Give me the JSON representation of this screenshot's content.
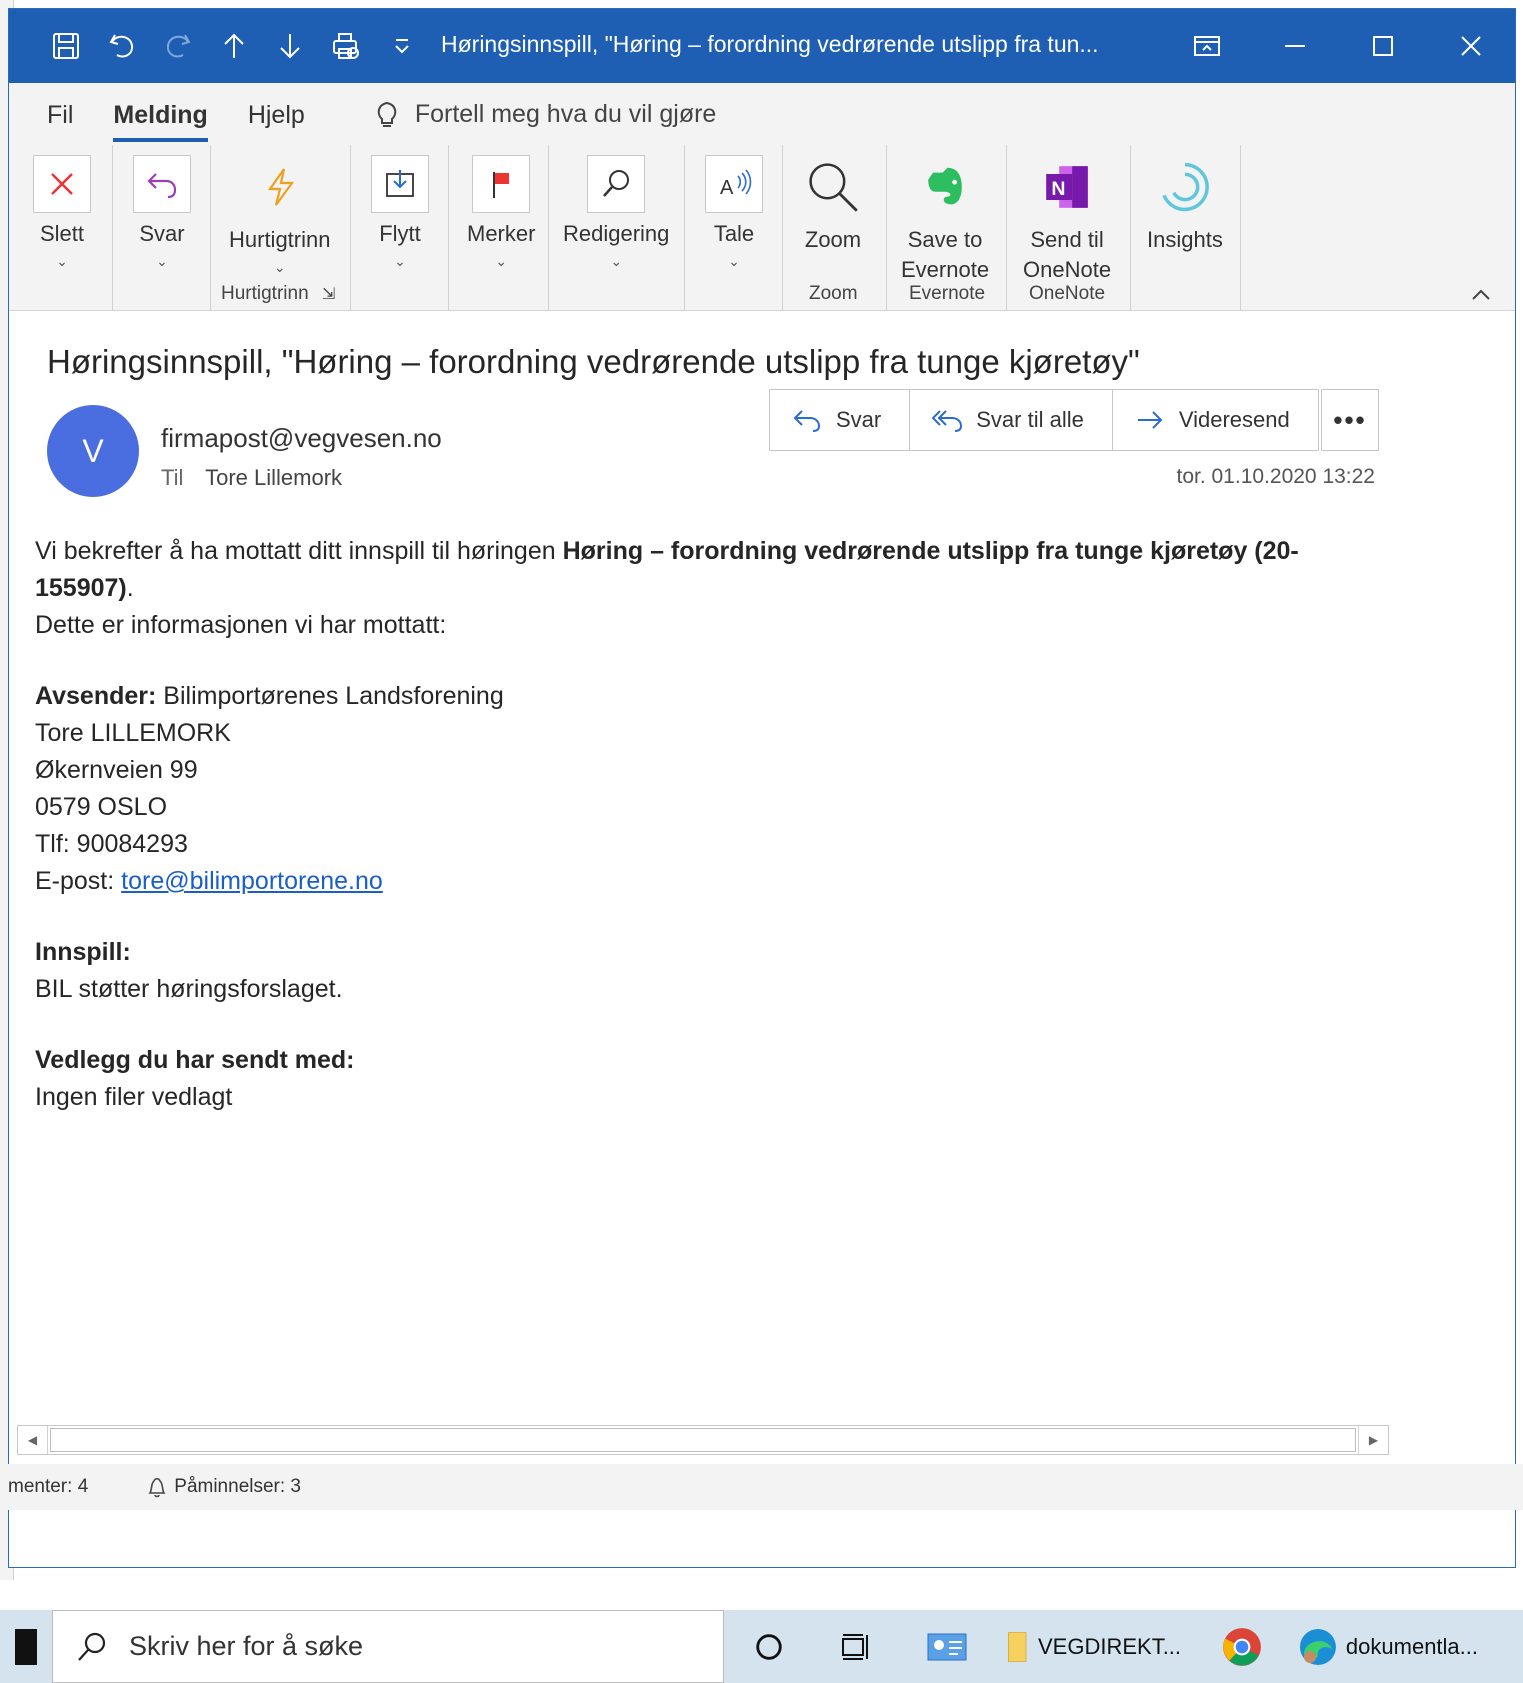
{
  "titlebar": {
    "title": "Høringsinnspill, \"Høring – forordning vedrørende utslipp fra tun..."
  },
  "tabs": {
    "items": [
      "Fil",
      "Melding",
      "Hjelp"
    ],
    "active": "Melding",
    "tellme": "Fortell meg hva du vil gjøre"
  },
  "ribbon": {
    "delete": "Slett",
    "reply": "Svar",
    "quicksteps": "Hurtigtrinn",
    "quicksteps_group": "Hurtigtrinn",
    "move": "Flytt",
    "tags": "Merker",
    "editing": "Redigering",
    "speech": "Tale",
    "zoom": "Zoom",
    "zoom_group": "Zoom",
    "evernote_line1": "Save to",
    "evernote_line2": "Evernote",
    "evernote_group": "Evernote",
    "onenote_line1": "Send til",
    "onenote_line2": "OneNote",
    "onenote_group": "OneNote",
    "insights": "Insights"
  },
  "message": {
    "subject": "Høringsinnspill, \"Høring – forordning vedrørende utslipp fra tunge kjøretøy\"",
    "avatar_initial": "V",
    "from": "firmapost@vegvesen.no",
    "to_label": "Til",
    "to": "Tore Lillemork",
    "date": "tor. 01.10.2020 13:22",
    "actions": {
      "reply": "Svar",
      "reply_all": "Svar til alle",
      "forward": "Videresend",
      "more": "•••"
    }
  },
  "body": {
    "intro": "Vi bekrefter å ha mottatt ditt innspill til høringen ",
    "hearing_title": "Høring – forordning vedrørende utslipp fra tunge kjøretøy (20-155907)",
    "intro_end": ".",
    "info_line": "Dette er informasjonen vi har mottatt:",
    "sender_label": "Avsender:",
    "sender_org": " Bilimportørenes Landsforening",
    "sender_name": "Tore LILLEMORK",
    "address": "Økernveien 99",
    "postal": "0579 OSLO",
    "phone": "Tlf: 90084293",
    "email_label": "E-post: ",
    "email": "tore@bilimportorene.no",
    "input_label": "Innspill:",
    "input_text": "BIL støtter høringsforslaget.",
    "attach_label": "Vedlegg du har sendt med:",
    "attach_text": "Ingen filer vedlagt"
  },
  "statusbar": {
    "items_label": "menter: 4",
    "reminders": "Påminnelser: 3"
  },
  "taskbar": {
    "search_placeholder": "Skriv her for å søke",
    "folder_label": "VEGDIREKT...",
    "edge_label": "dokumentla..."
  },
  "colors": {
    "titlebar": "#1f5fb3",
    "accent": "#1f5fb3",
    "link": "#1a5fc8",
    "avatar": "#4a6ee0"
  }
}
